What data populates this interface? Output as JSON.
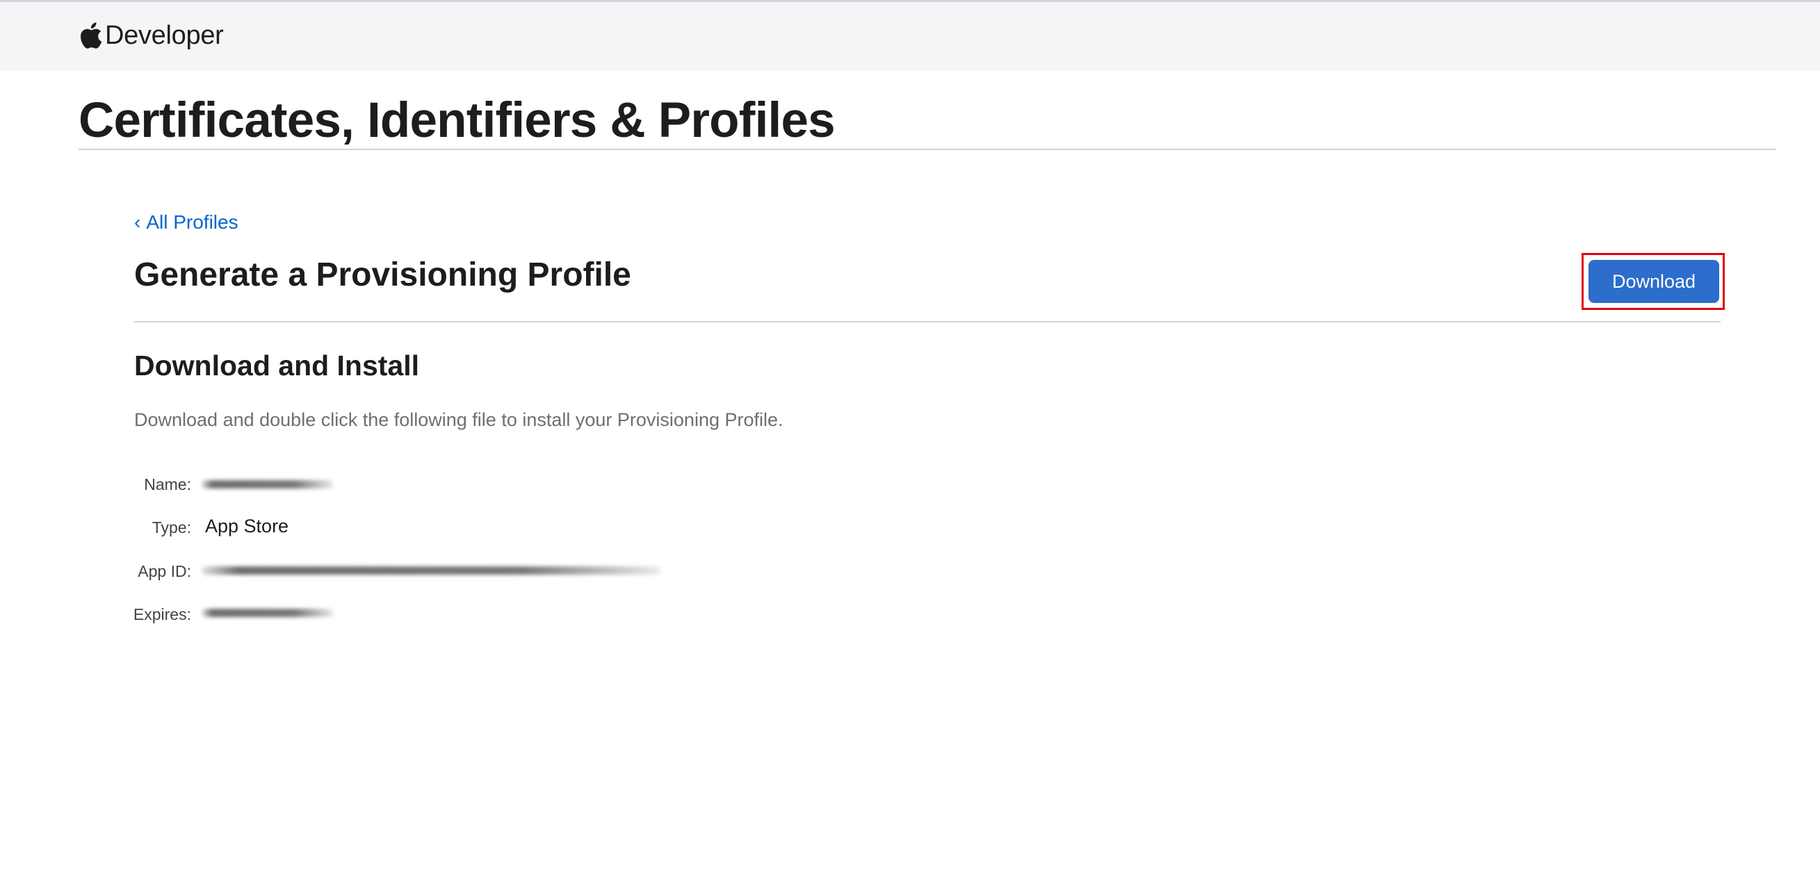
{
  "header": {
    "brand_name": "Developer",
    "logo_icon": "apple-logo-icon"
  },
  "page": {
    "title": "Certificates, Identifiers & Profiles"
  },
  "breadcrumb": {
    "back_chevron": "‹",
    "back_label": "All Profiles"
  },
  "section": {
    "title": "Generate a Provisioning Profile",
    "download_label": "Download",
    "download_color": "#2d6dcc",
    "highlight_color": "#e3000f"
  },
  "install": {
    "title": "Download and Install",
    "instruction": "Download and double click the following file to install your Provisioning Profile."
  },
  "details": {
    "name_label": "Name:",
    "type_label": "Type:",
    "type_value": "App Store",
    "app_id_label": "App ID:",
    "expires_label": "Expires:"
  },
  "colors": {
    "link": "#0066cc",
    "nav_background": "#f5f5f7",
    "rule": "#d2d2d7"
  }
}
